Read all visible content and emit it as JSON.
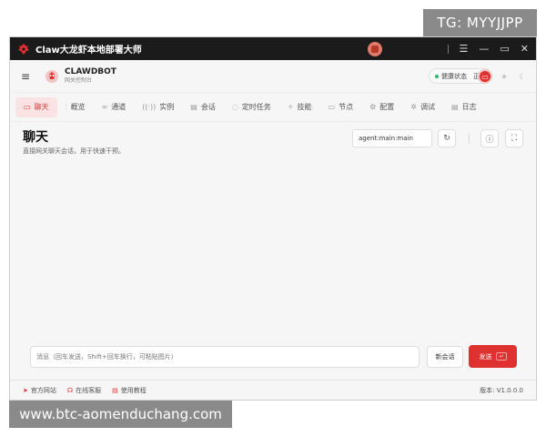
{
  "overlay": {
    "tg_text": "TG: MYYJJPP",
    "watermark_text": "www.btc-aomenduchang.com"
  },
  "titlebar": {
    "title": "Claw大龙虾本地部署大师",
    "logo_icon": "lobster-logo-icon",
    "center_icon": "app-status-icon",
    "controls": [
      "menu-icon",
      "minimize-icon",
      "maximize-icon",
      "close-icon"
    ]
  },
  "header": {
    "brand_name": "CLAWDBOT",
    "brand_sub": "网关控制台",
    "status_label": "健康状态",
    "status_value": "正常",
    "status_color": "#2eb86b"
  },
  "tabs": [
    {
      "label": "聊天",
      "icon": "chat-icon",
      "active": true
    },
    {
      "label": "概览",
      "icon": "bar-chart-icon",
      "active": false
    },
    {
      "label": "通道",
      "icon": "link-icon",
      "active": false
    },
    {
      "label": "实例",
      "icon": "broadcast-icon",
      "active": false
    },
    {
      "label": "会话",
      "icon": "document-icon",
      "active": false
    },
    {
      "label": "定时任务",
      "icon": "clock-icon",
      "active": false
    },
    {
      "label": "技能",
      "icon": "spark-icon",
      "active": false
    },
    {
      "label": "节点",
      "icon": "monitor-icon",
      "active": false
    },
    {
      "label": "配置",
      "icon": "gear-icon",
      "active": false
    },
    {
      "label": "调试",
      "icon": "bug-icon",
      "active": false
    },
    {
      "label": "日志",
      "icon": "log-icon",
      "active": false
    }
  ],
  "page": {
    "title": "聊天",
    "subtitle": "直接网关聊天会话，用于快速干预。",
    "session_value": "agent:main:main"
  },
  "composer": {
    "placeholder": "消息（回车发送，Shift+回车换行，可粘贴图片）",
    "new_session_label": "新会话",
    "send_label": "发送",
    "send_shortcut": "↵"
  },
  "footer": {
    "links": [
      {
        "label": "官方网站",
        "icon": "rocket-icon"
      },
      {
        "label": "在线客服",
        "icon": "headset-icon"
      },
      {
        "label": "使用教程",
        "icon": "book-icon"
      }
    ],
    "version": "版本: V1.0.0.0"
  },
  "colors": {
    "accent": "#e03131",
    "titlebar_bg": "#1b1b1b",
    "active_tab_bg": "#fbe3e3"
  }
}
